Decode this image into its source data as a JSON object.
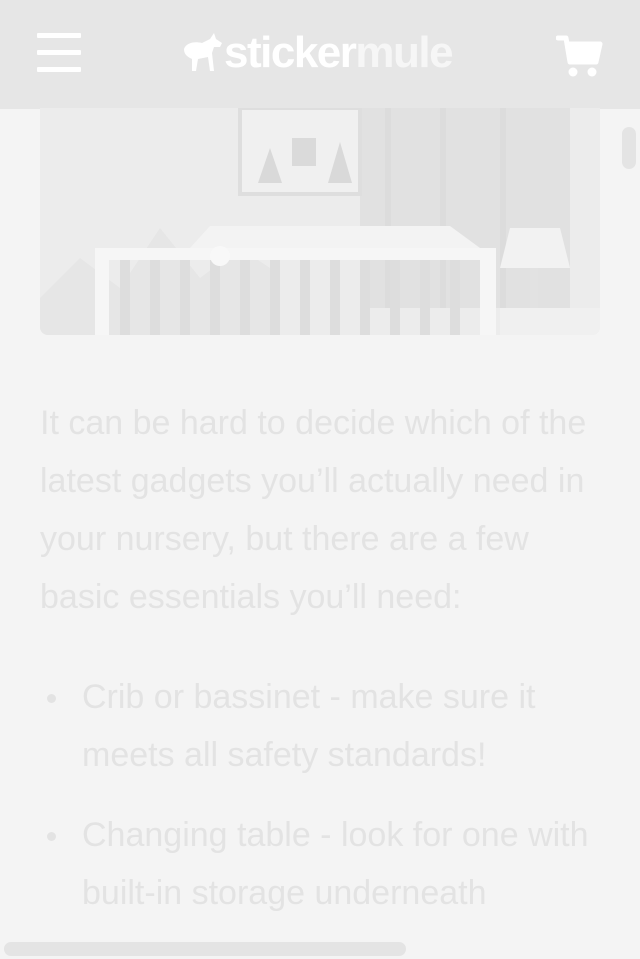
{
  "header": {
    "logo_primary": "sticker",
    "logo_secondary": "mule",
    "menu_icon": "hamburger-menu-icon",
    "cart_icon": "shopping-cart-icon",
    "logo_icon": "mule-logo-icon"
  },
  "hero_image": {
    "subject": "nursery-crib-image"
  },
  "article": {
    "intro": "It can be hard to decide which of the latest gadgets you’ll actually need in your nursery, but there are a few basic essentials you’ll need:",
    "items": [
      "Crib or bassinet - make sure it meets all safety standards!",
      "Changing table - look for one with built-in storage underneath"
    ]
  },
  "colors": {
    "header_bg": "#e6e6e6",
    "page_bg": "#f4f4f4",
    "text": "#e3e3e3"
  }
}
